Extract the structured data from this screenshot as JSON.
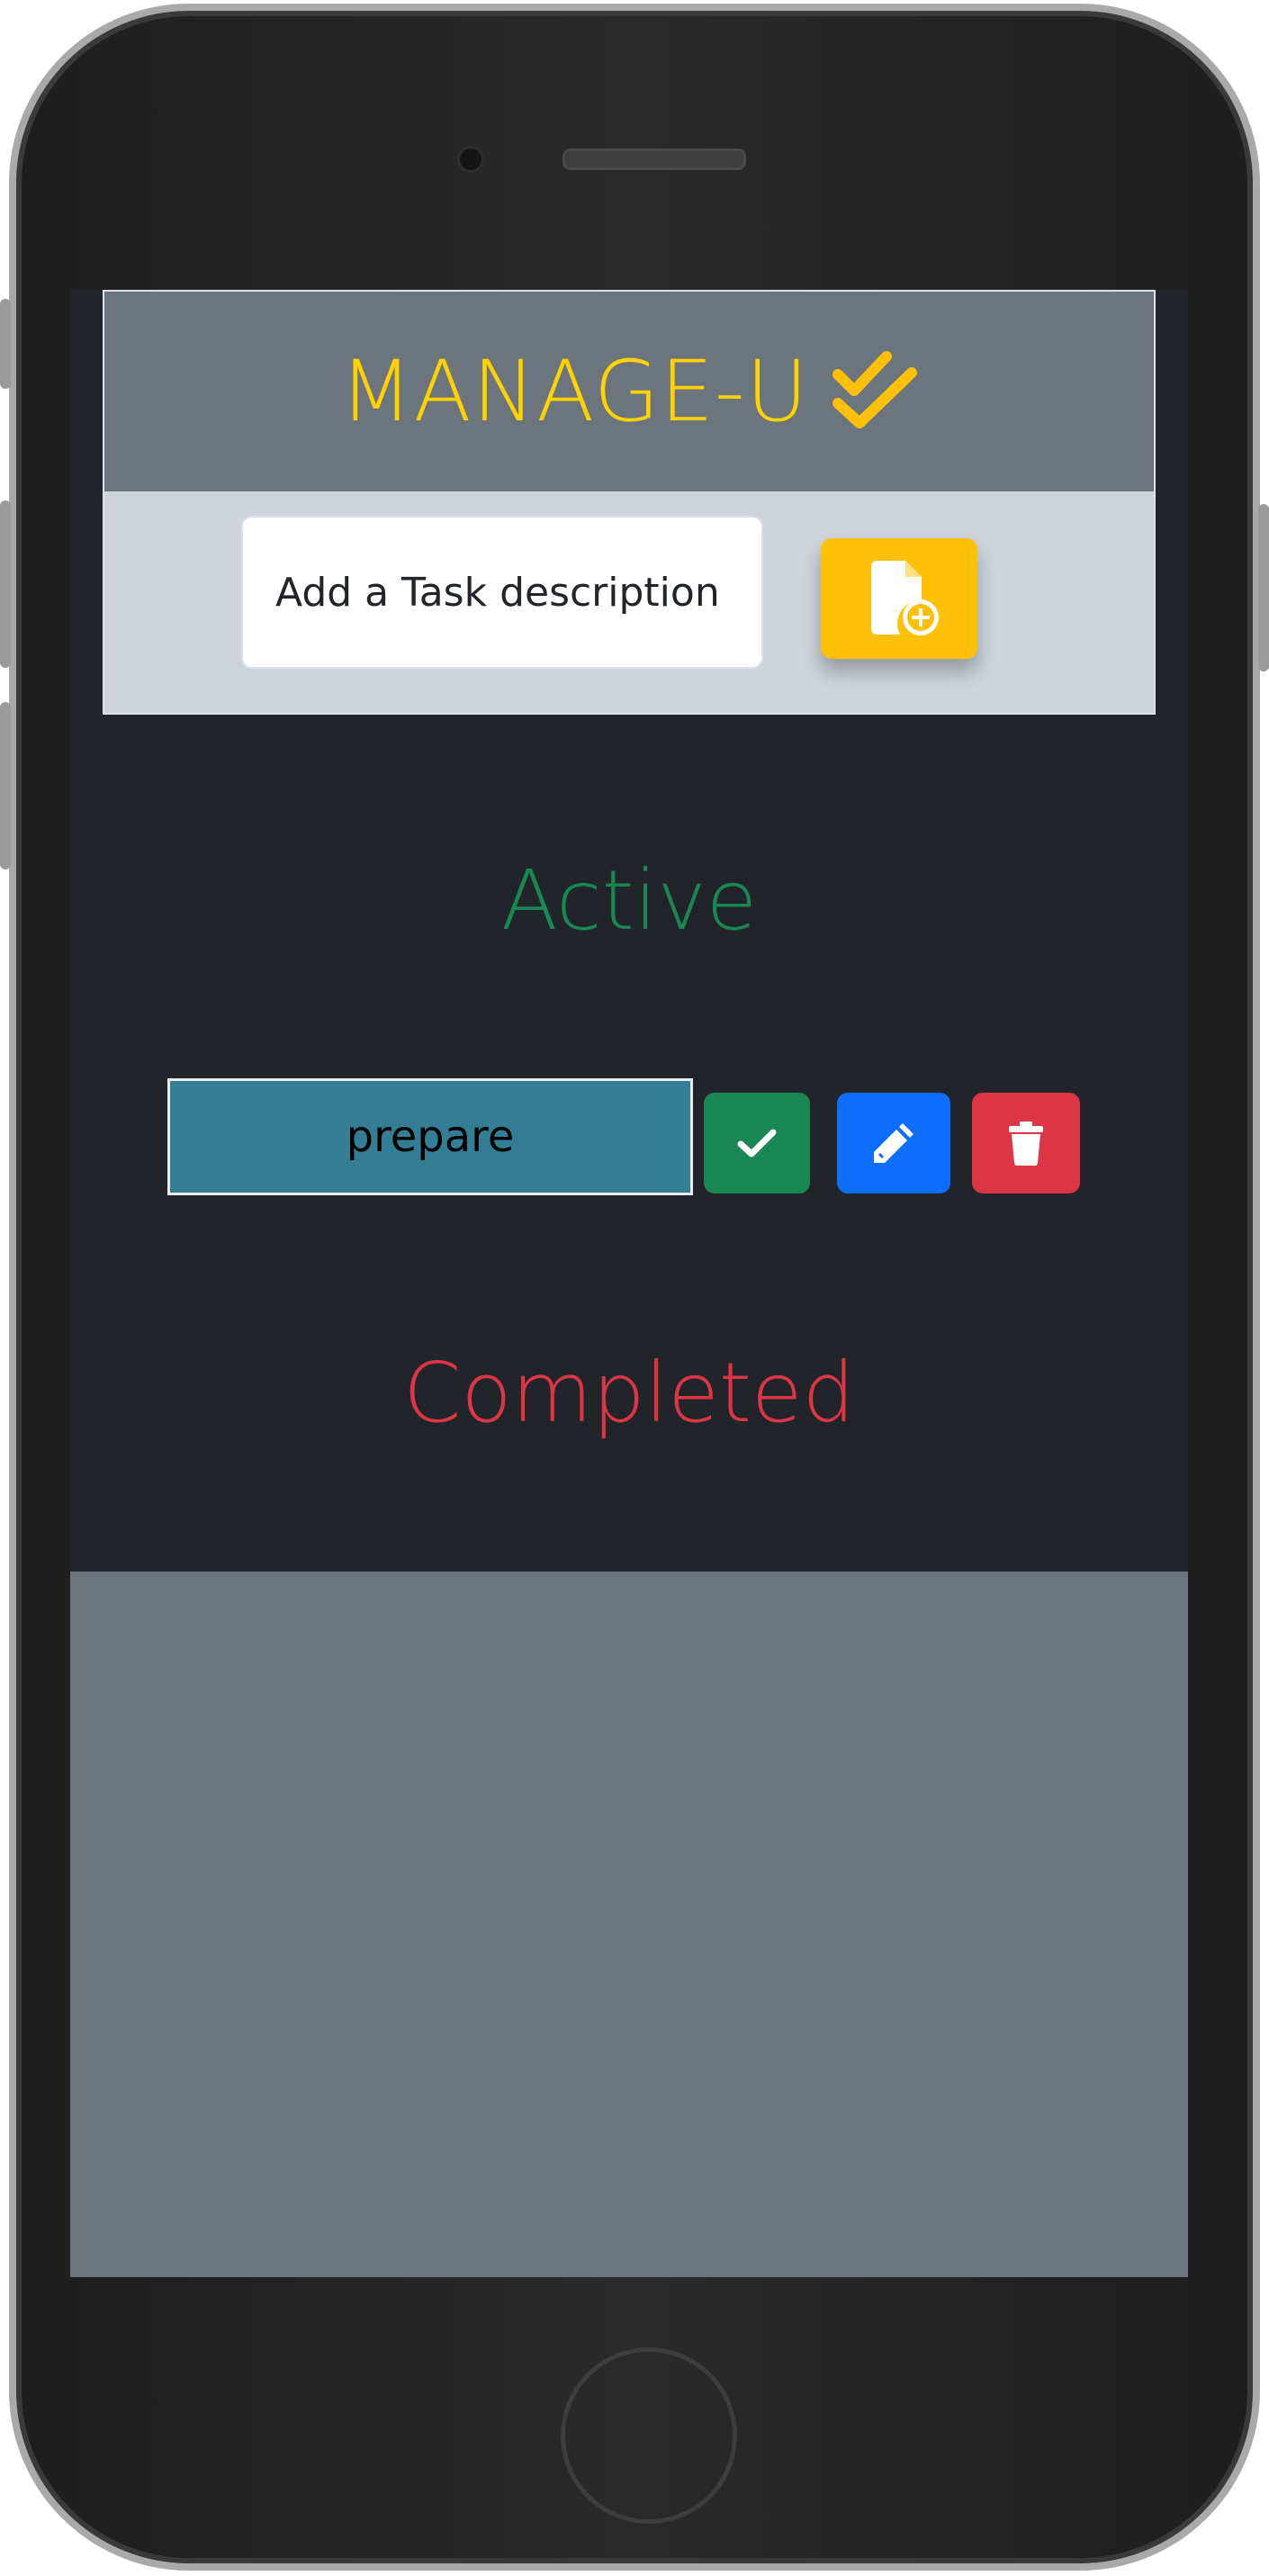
{
  "app": {
    "title": "MANAGE-U",
    "title_icon": "double-check-icon",
    "colors": {
      "accent": "#ffd200",
      "add_button": "#ffc107",
      "active": "#198754",
      "completed": "#dc3545",
      "task_background": "#337e95",
      "edit": "#0d6efd"
    }
  },
  "new_task": {
    "placeholder": "Add a Task description",
    "value": "",
    "add_icon": "file-add-icon"
  },
  "sections": {
    "active_label": "Active",
    "completed_label": "Completed"
  },
  "active_tasks": [
    {
      "description": "prepare",
      "actions": [
        {
          "name": "complete",
          "icon": "check-icon"
        },
        {
          "name": "edit",
          "icon": "pencil-icon"
        },
        {
          "name": "delete",
          "icon": "trash-icon"
        }
      ]
    }
  ],
  "completed_tasks": []
}
